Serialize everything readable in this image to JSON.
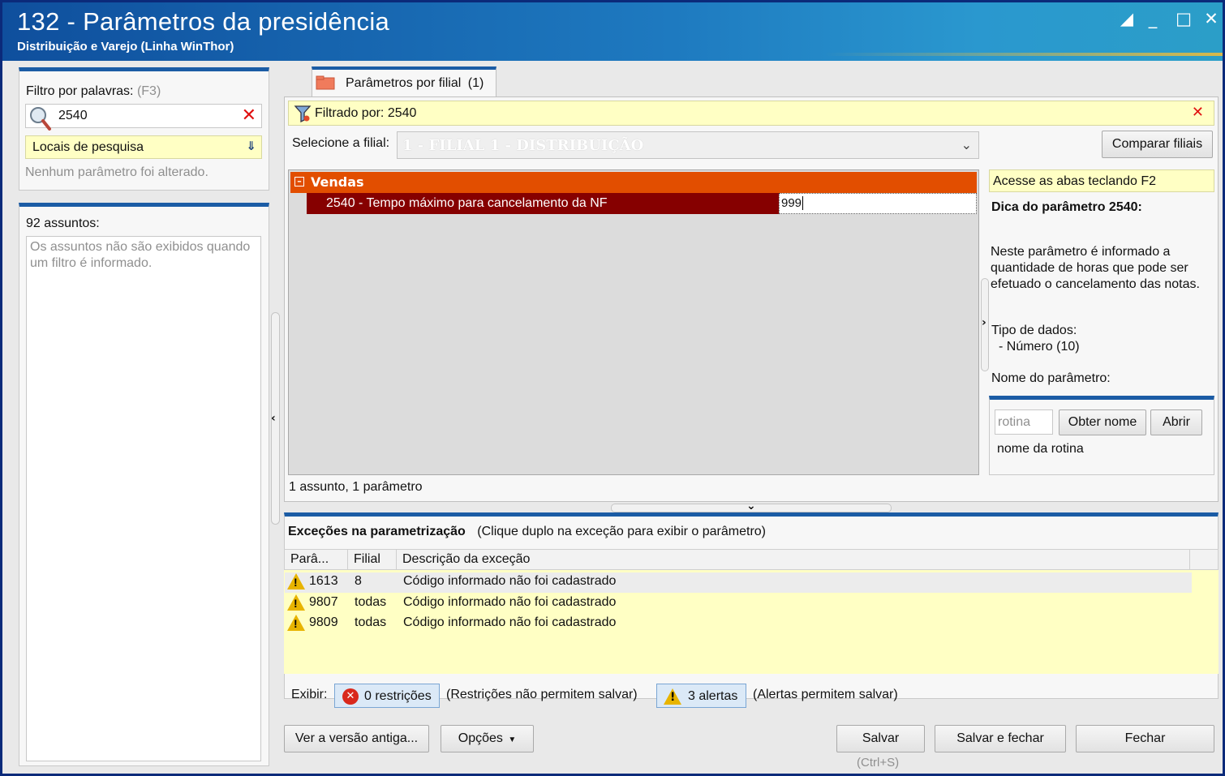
{
  "window": {
    "title": "132 - Parâmetros da presidência",
    "subtitle": "Distribuição e Varejo (Linha WinThor)"
  },
  "left": {
    "filter_label": "Filtro por palavras:",
    "filter_shortcut": "(F3)",
    "filter_value": "2540",
    "search_locations": "Locais de pesquisa",
    "no_change": "Nenhum parâmetro foi alterado.",
    "subjects_count": "92 assuntos:",
    "subjects_note": "Os assuntos não são exibidos quando um filtro é informado."
  },
  "tab": {
    "label": "Parâmetros por filial",
    "count": "(1)"
  },
  "filter_bar": {
    "text": "Filtrado por: 2540"
  },
  "branch": {
    "label": "Selecione a filial:",
    "value": "1 - FILIAL 1 - DISTRIBUIÇÃO",
    "compare_button": "Comparar filiais"
  },
  "grid": {
    "group": "Vendas",
    "param_label": "2540 - Tempo máximo para cancelamento da NF",
    "param_value": "999",
    "status": "1 assunto, 1 parâmetro"
  },
  "tip": {
    "shortcut_hint": "Acesse as abas teclando F2",
    "title": "Dica do parâmetro 2540:",
    "body": "Neste parâmetro é informado a quantidade de horas que pode ser efetuado o cancelamento das notas.",
    "data_type_label": "Tipo de dados:",
    "data_type_value": "- Número (10)",
    "param_name_label": "Nome do parâmetro:",
    "routine_placeholder": "rotina",
    "get_name_button": "Obter nome",
    "open_button": "Abrir",
    "routine_name": "nome da rotina"
  },
  "exceptions": {
    "title": "Exceções na parametrização",
    "hint": "(Clique duplo na exceção para exibir o parâmetro)",
    "columns": [
      "Parâ...",
      "Filial",
      "Descrição da exceção"
    ],
    "rows": [
      {
        "param": "1613",
        "branch": "8",
        "desc": "Código informado não foi cadastrado"
      },
      {
        "param": "9807",
        "branch": "todas",
        "desc": "Código informado não foi cadastrado"
      },
      {
        "param": "9809",
        "branch": "todas",
        "desc": "Código informado não foi cadastrado"
      }
    ],
    "show_label": "Exibir:",
    "restrictions_button": "0 restrições",
    "restrictions_note": "(Restrições não permitem salvar)",
    "alerts_button": "3 alertas",
    "alerts_note": "(Alertas permitem salvar)"
  },
  "footer": {
    "old_version_button": "Ver a versão antiga...",
    "options_button": "Opções",
    "save_button": "Salvar",
    "save_shortcut": "(Ctrl+S)",
    "save_close_button": "Salvar e fechar",
    "close_button": "Fechar"
  },
  "colors": {
    "title_bar": "#1e7ac0",
    "group_header": "#e24e00",
    "selected_row": "#860000",
    "highlight_yellow": "#ffffc4",
    "accent_blue": "#1b5ca5"
  }
}
